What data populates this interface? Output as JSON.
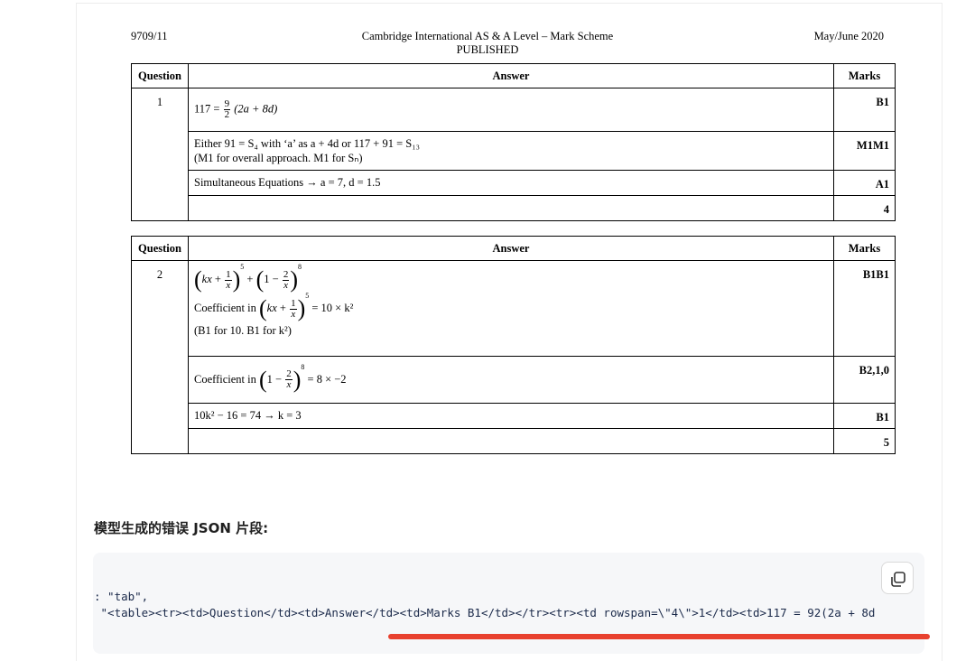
{
  "header": {
    "code": "9709/11",
    "title_line1": "Cambridge International AS & A Level – Mark Scheme",
    "title_line2": "PUBLISHED",
    "date": "May/June 2020"
  },
  "table_headers": {
    "question": "Question",
    "answer": "Answer",
    "marks": "Marks"
  },
  "q1": {
    "number": "1",
    "row1_prefix": "117 =",
    "row1_frac_num": "9",
    "row1_frac_den": "2",
    "row1_rest": "(2a + 8d)",
    "row1_mark": "B1",
    "row2_text_a": "Either 91 = S₄ with ‘a’ as a + 4d or 117 + 91 = S₁₃",
    "row2_text_b": "(M1 for overall approach. M1 for Sₙ)",
    "row2_mark": "M1M1",
    "row3_text": "Simultaneous Equations → a = 7, d = 1.5",
    "row3_mark": "A1",
    "total": "4"
  },
  "q2": {
    "number": "2",
    "row1_label": "Coefficient in",
    "row1_result": "= 10 × k²",
    "row1_note": "(B1 for 10. B1 for k²)",
    "row1_mark": "B1B1",
    "row2_label": "Coefficient in",
    "row2_result": "= 8 × −2",
    "row2_mark": "B2,1,0",
    "row3_text": "10k² − 16 = 74 → k = 3",
    "row3_mark": "B1",
    "total": "5"
  },
  "section_heading": "模型生成的错误 JSON 片段:",
  "code": {
    "line1": ": \"tab\",",
    "line2": " \"<table><tr><td>Question</td><td>Answer</td><td>Marks B1</td></tr><tr><td rowspan=\\\"4\\\">1</td><td>117 = 92(2a + 8d"
  },
  "icons": {
    "copy": "copy-icon"
  },
  "colors": {
    "accent_underline": "#e8412f",
    "code_bg": "#f6f7f9"
  }
}
